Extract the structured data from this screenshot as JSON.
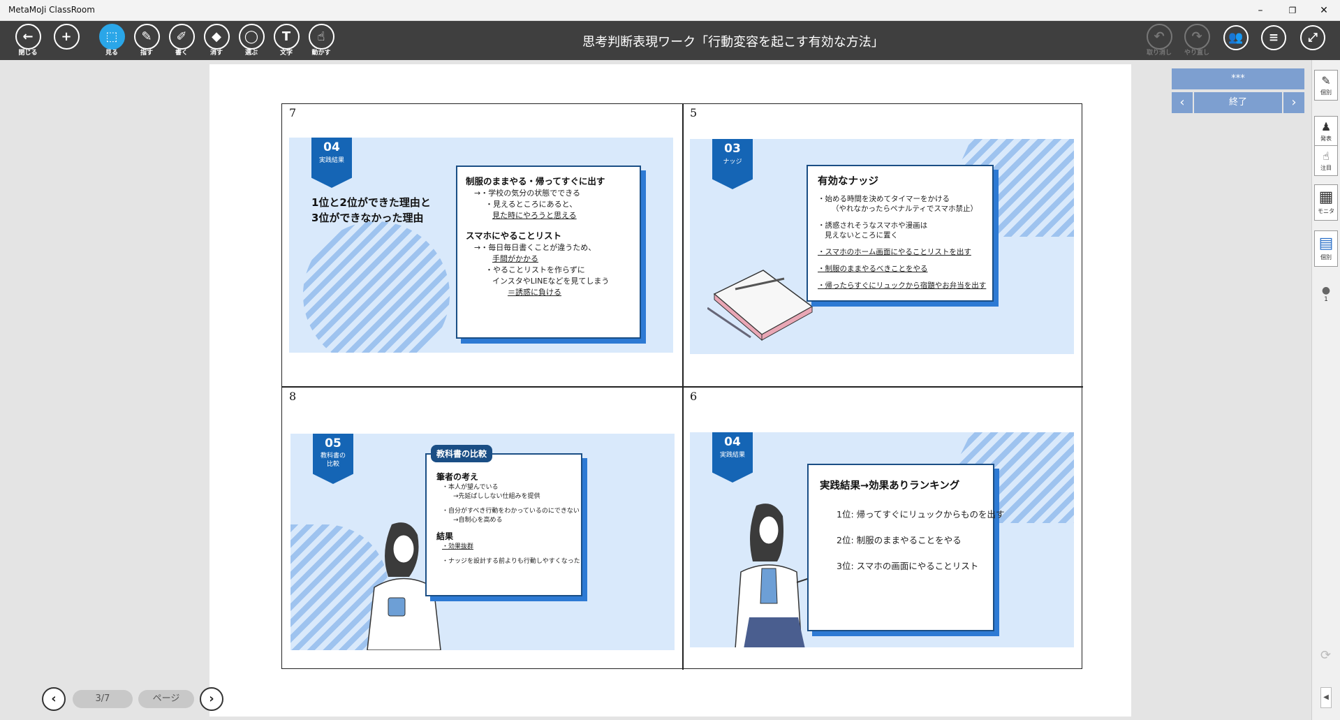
{
  "app": {
    "title": "MetaMoJi ClassRoom"
  },
  "window": {
    "minimize": "–",
    "restore": "❐",
    "close": "✕"
  },
  "toolbar": {
    "tools": [
      {
        "id": "close",
        "label": "閉じる",
        "icon": "←"
      },
      {
        "id": "add",
        "label": "",
        "icon": "+"
      },
      {
        "id": "view",
        "label": "見る",
        "icon": "⬚"
      },
      {
        "id": "point",
        "label": "指す",
        "icon": "✎"
      },
      {
        "id": "write",
        "label": "書く",
        "icon": "✐"
      },
      {
        "id": "erase",
        "label": "消す",
        "icon": "◆"
      },
      {
        "id": "select",
        "label": "選ぶ",
        "icon": "◯"
      },
      {
        "id": "text",
        "label": "文字",
        "icon": "T"
      },
      {
        "id": "move",
        "label": "動かす",
        "icon": "☝"
      }
    ],
    "title": "思考判断表現ワーク「行動変容を起こす有効な方法」",
    "undo": {
      "label": "取り消し",
      "icon": "↶"
    },
    "redo": {
      "label": "やり直し",
      "icon": "↷"
    },
    "group_icon": "👥",
    "menu_icon": "≡",
    "expand_icon": "⤢"
  },
  "cells": [
    {
      "number": "7",
      "badge": {
        "num": "04",
        "text": "実践結果"
      },
      "big": [
        "1位と2位ができた理由と",
        "3位ができなかった理由"
      ],
      "card": {
        "h1": "制服のままやる・帰ってすぐに出す",
        "l1": "→・学校の気分の状態でできる",
        "l2": "・見えるところにあると、",
        "l3": "見た時にやろうと思える",
        "h2": "スマホにやることリスト",
        "l4": "→・毎日毎日書くことが違うため、",
        "l5": "手間がかかる",
        "l6": "・やることリストを作らずに",
        "l7": "インスタやLINEなどを見てしまう",
        "l8": "＝誘惑に負ける"
      }
    },
    {
      "number": "5",
      "badge": {
        "num": "03",
        "text": "ナッジ"
      },
      "card": {
        "h": "有効なナッジ",
        "l1": "・始める時間を決めてタイマーをかける",
        "l2": "（やれなかったらペナルティでスマホ禁止）",
        "l3": "・誘惑されそうなスマホや漫画は",
        "l4": "見えないところに置く",
        "l5": "・スマホのホーム画面にやることリストを出す",
        "l6": "・制服のままやるべきことをやる",
        "l7": "・帰ったらすぐにリュックから宿題やお弁当を出す"
      }
    },
    {
      "number": "8",
      "badge": {
        "num": "05",
        "text1": "教科書の",
        "text2": "比較"
      },
      "card": {
        "tab": "教科書の比較",
        "h1": "筆者の考え",
        "l1": "・本人が望んでいる",
        "l2": "→先延ばししない仕組みを提供",
        "l3": "・自分がすべき行動をわかっているのにできない",
        "l4": "→自制心を高める",
        "h2": "結果",
        "l5": "・効果抜群",
        "l6": "・ナッジを設計する前よりも行動しやすくなった"
      }
    },
    {
      "number": "6",
      "badge": {
        "num": "04",
        "text": "実践結果"
      },
      "card": {
        "h": "実践結果→効果ありランキング",
        "r1": "1位: 帰ってすぐにリュックからものを出す",
        "r2": "2位: 制服のままやることをやる",
        "r3": "3位: スマホの画面にやることリスト"
      }
    }
  ],
  "pager": {
    "prev": "‹",
    "next": "›",
    "page": "3/7",
    "page_label": "ページ"
  },
  "panel": {
    "top": "***",
    "prev": "‹",
    "end": "終了",
    "next": "›"
  },
  "strip": [
    {
      "label": "個別",
      "icon": "✎"
    },
    {
      "label": "発表",
      "icon": "♟"
    },
    {
      "label": "注目",
      "icon": "☝"
    },
    {
      "label": "モニタ",
      "icon": "▦"
    },
    {
      "label": "個別",
      "icon": "▤"
    },
    {
      "label": "1",
      "icon": "●"
    }
  ],
  "colors": {
    "accent": "#2aa6e8",
    "badge": "#1565b5",
    "slide_bg": "#d9e9fb",
    "panel": "#7d9fd0"
  }
}
